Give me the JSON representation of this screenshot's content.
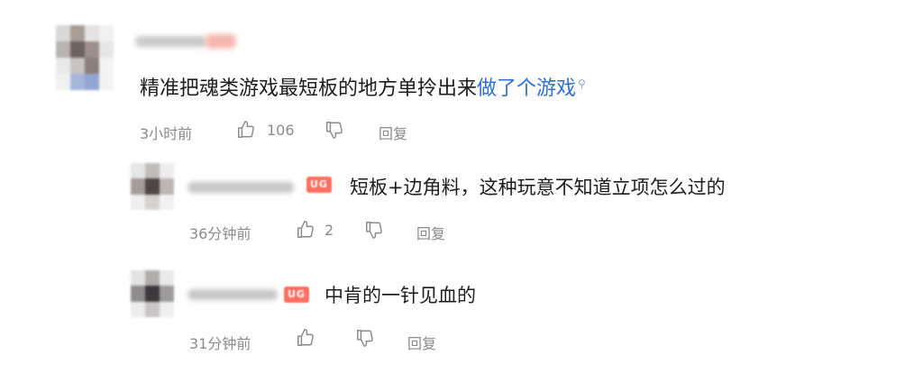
{
  "comments": [
    {
      "text": "精准把魂类游戏最短板的地方单拎出来",
      "link_text": "做了个游戏",
      "link_icon": "search-icon",
      "time": "3小时前",
      "likes": "106",
      "reply_label": "回复"
    },
    {
      "badge": "UG",
      "text": "短板+边角料，这种玩意不知道立项怎么过的",
      "time": "36分钟前",
      "likes": "2",
      "reply_label": "回复"
    },
    {
      "badge": "UG",
      "text": "中肯的一针见血的",
      "time": "31分钟前",
      "reply_label": "回复"
    }
  ],
  "icons": {
    "like": "thumbs-up-icon",
    "dislike": "thumbs-down-icon"
  },
  "colors": {
    "link": "#2f6fcf",
    "meta": "#8b8b8b",
    "badge": "#ff6f61"
  }
}
